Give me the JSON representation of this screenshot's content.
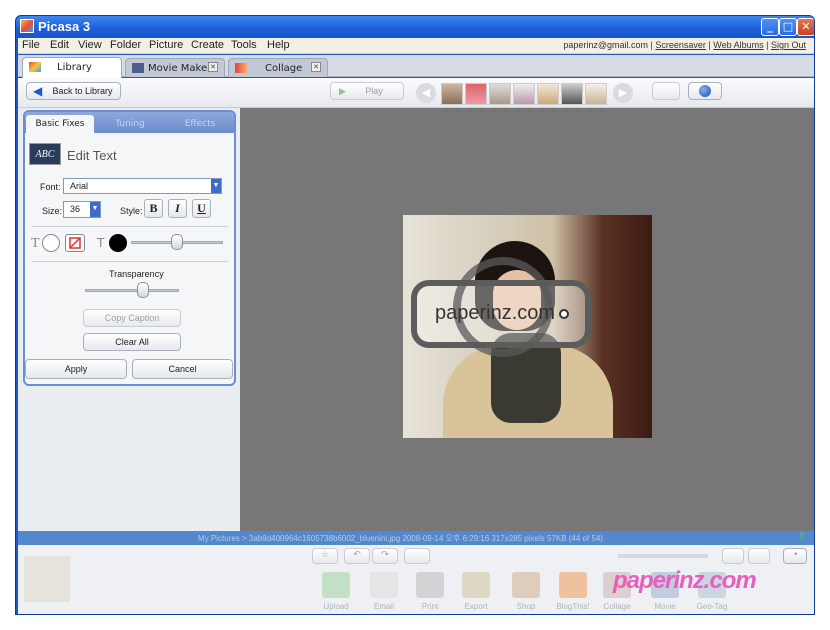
{
  "window": {
    "title": "Picasa 3"
  },
  "menu": {
    "items": [
      "File",
      "Edit",
      "View",
      "Folder",
      "Picture",
      "Create",
      "Tools",
      "Help"
    ],
    "account_email": "paperinz@gmail.com",
    "links": [
      "Screensaver",
      "Web Albums",
      "Sign Out"
    ]
  },
  "tabs": [
    {
      "label": "Library",
      "active": true
    },
    {
      "label": "Movie Maker",
      "active": false
    },
    {
      "label": "Collage",
      "active": false
    }
  ],
  "toolbar": {
    "back_label": "Back to Library",
    "play_label": "Play"
  },
  "panel": {
    "tabs": [
      "Basic Fixes",
      "Tuning",
      "Effects"
    ],
    "heading": "Edit Text",
    "font_label": "Font:",
    "font_value": "Arial",
    "size_label": "Size:",
    "size_value": "36",
    "style_label": "Style:",
    "bold": "B",
    "italic": "I",
    "underline": "U",
    "transparency_label": "Transparency",
    "transparency_level": 0.62,
    "copy_caption": "Copy Caption",
    "clear_all": "Clear All",
    "apply": "Apply",
    "cancel": "Cancel",
    "text_color": "#ffffff",
    "outline_color": "#000000"
  },
  "photo": {
    "overlay_text": "paperinz.com"
  },
  "status": {
    "text": "My Pictures > 3ab9d400964c1605738b6002_bluenini.jpg     2008-09-14 오후 6:29:16     317x285 pixels     57KB     (44 of 54)"
  },
  "tray": {
    "items": [
      "Upload",
      "Email",
      "Print",
      "Export",
      "Shop",
      "BlogThis!",
      "Collage",
      "Movie",
      "Geo-Tag"
    ]
  },
  "watermark": "paperinz.com",
  "colors": {
    "title_bar": "#1c5ed9",
    "panel_border": "#6b8fd3",
    "status_bar": "#5488cc",
    "watermark": "#e85fbf"
  }
}
